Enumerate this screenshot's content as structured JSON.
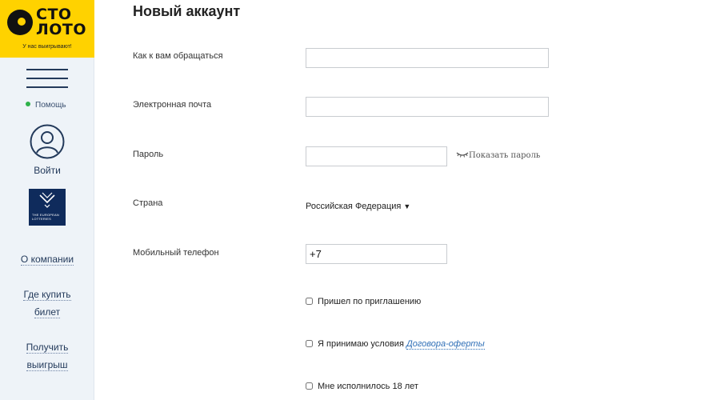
{
  "sidebar": {
    "logo": {
      "line1": "СТО",
      "line2": "ЛОТО",
      "tagline": "У нас выигрывают!"
    },
    "help_label": "Помощь",
    "login_label": "Войти",
    "eu_logo_text": "THE EUROPEAN LOTTERIES",
    "links": [
      {
        "line1": "О компании",
        "line2": ""
      },
      {
        "line1": "Где купить",
        "line2": "билет"
      },
      {
        "line1": "Получить",
        "line2": "выигрыш"
      }
    ]
  },
  "form": {
    "title": "Новый аккаунт",
    "name_label": "Как к вам обращаться",
    "name_value": "",
    "email_label": "Электронная почта",
    "email_value": "",
    "password_label": "Пароль",
    "password_value": "",
    "show_password": "Показать пароль",
    "country_label": "Страна",
    "country_value": "Российская Федерация",
    "phone_label": "Мобильный телефон",
    "phone_value": "+7",
    "checkbox_invite": "Пришел по приглашению",
    "checkbox_terms": "Я принимаю условия",
    "terms_link": "Договора-оферты",
    "checkbox_age": "Мне исполнилось 18 лет"
  },
  "colors": {
    "brand_yellow": "#ffd200",
    "nav_text": "#233a5b",
    "help_dot": "#2fb24a",
    "link": "#2f6fb7"
  }
}
